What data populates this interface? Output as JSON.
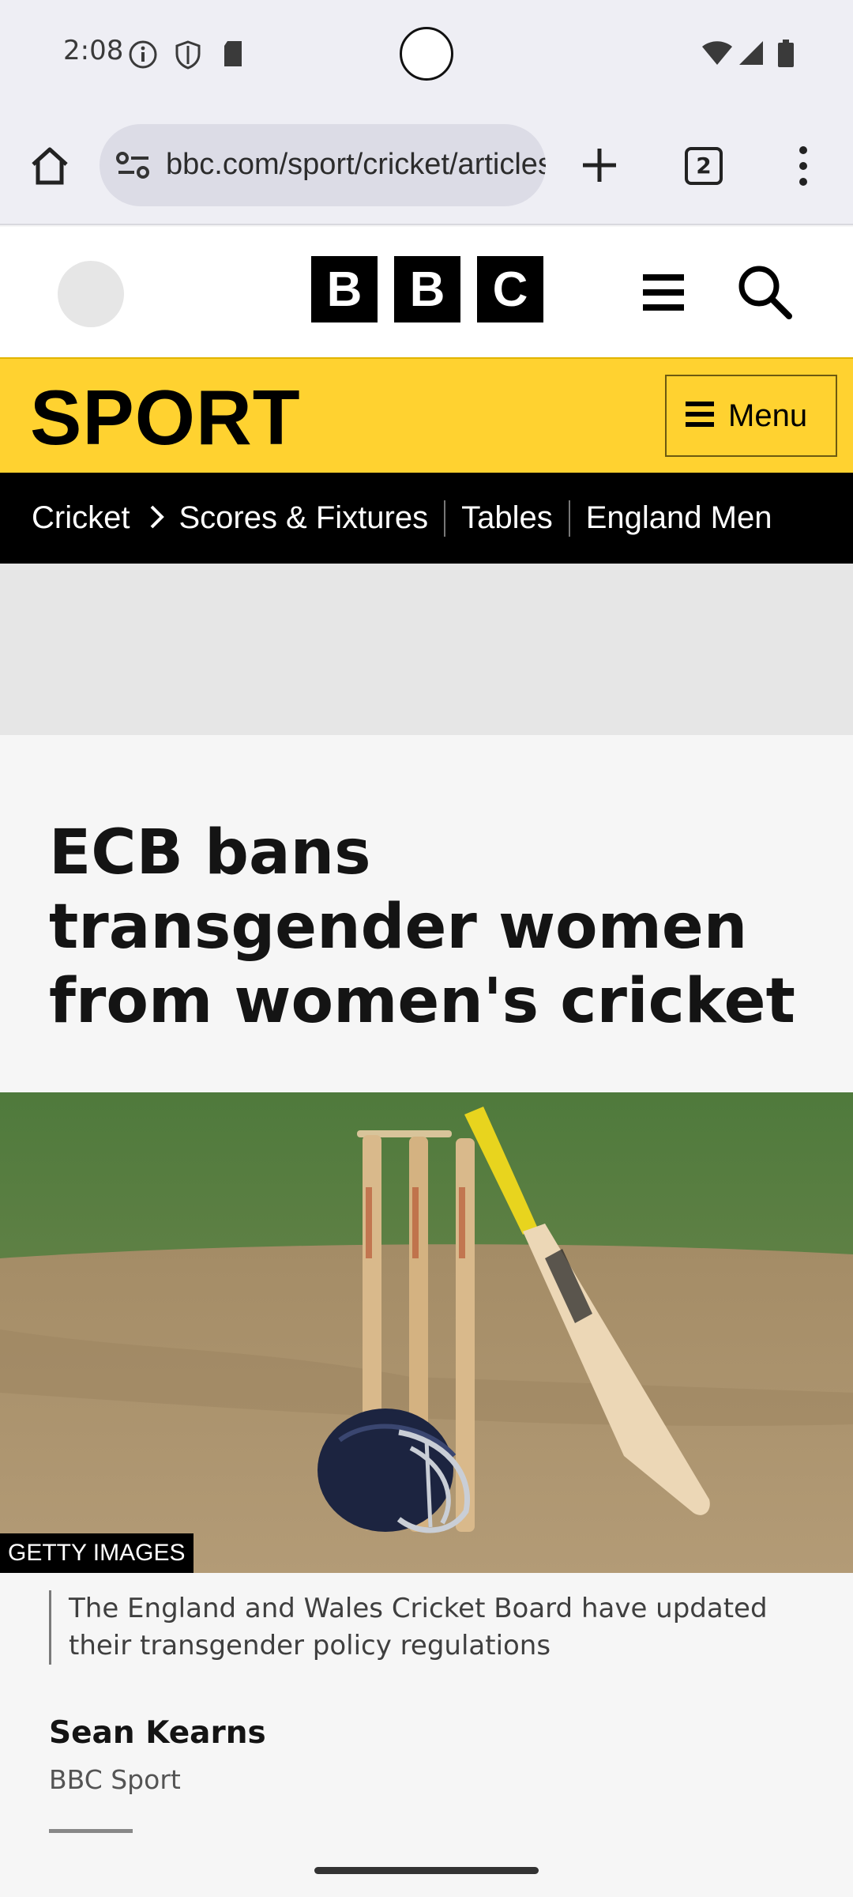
{
  "status_bar": {
    "time": "2:08",
    "icons": [
      "info-icon",
      "shield-icon",
      "sd-card-icon",
      "wifi-icon",
      "signal-icon",
      "battery-icon"
    ]
  },
  "browser": {
    "url": "bbc.com/sport/cricket/articles",
    "tab_count": "2",
    "icons": [
      "home-icon",
      "site-settings-icon",
      "new-tab-plus-icon",
      "tabs-icon",
      "overflow-menu-icon"
    ]
  },
  "bbc_header": {
    "logo_letters": [
      "B",
      "B",
      "C"
    ],
    "icons": [
      "account-avatar",
      "hamburger-icon",
      "search-icon"
    ]
  },
  "sport": {
    "title": "SPORT",
    "menu_label": "Menu"
  },
  "nav": {
    "items": [
      "Cricket",
      "Scores & Fixtures",
      "Tables",
      "England Men"
    ]
  },
  "article": {
    "headline": "ECB bans transgender women from women's cricket",
    "image_credit": "GETTY IMAGES",
    "caption": "The England and Wales Cricket Board have updated their transgender policy regulations",
    "author": "Sean Kearns",
    "organization": "BBC Sport"
  },
  "colors": {
    "sport_yellow": "#ffd230",
    "nav_black": "#000000",
    "page_bg": "#f6f6f6"
  }
}
